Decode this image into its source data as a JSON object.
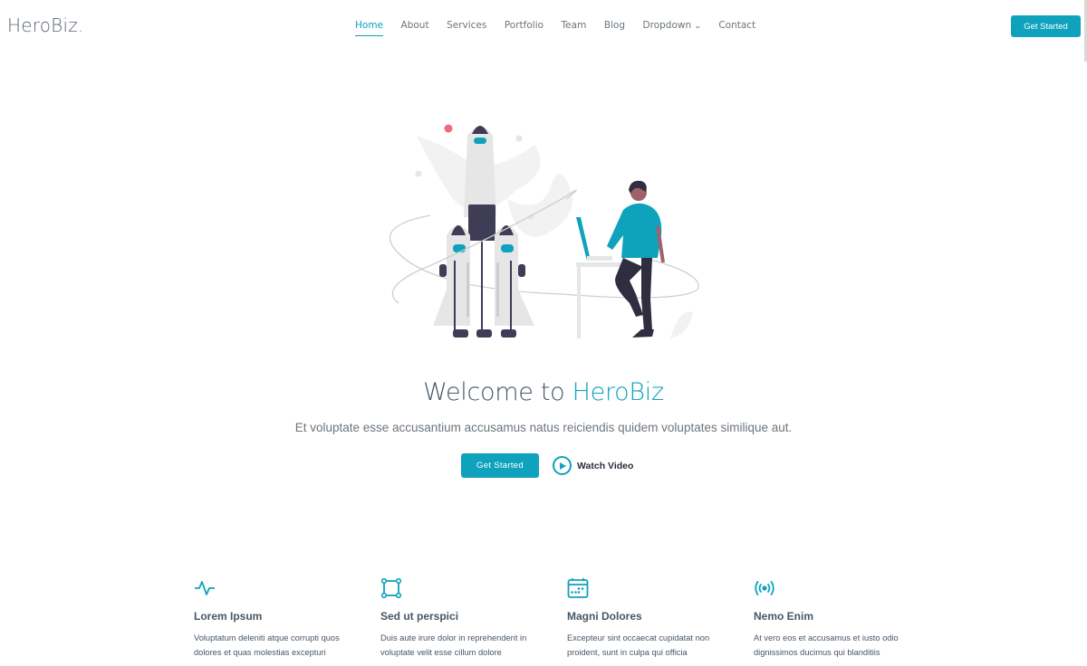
{
  "header": {
    "logo": "HeroBiz",
    "logo_dot": ".",
    "nav": [
      {
        "label": "Home",
        "active": true
      },
      {
        "label": "About"
      },
      {
        "label": "Services"
      },
      {
        "label": "Portfolio"
      },
      {
        "label": "Team"
      },
      {
        "label": "Blog"
      },
      {
        "label": "Dropdown",
        "icon": "chevron-down-icon"
      },
      {
        "label": "Contact"
      }
    ],
    "cta": "Get Started"
  },
  "hero": {
    "title_prefix": "Welcome to ",
    "title_brand": "HeroBiz",
    "subtitle": "Et voluptate esse accusantium accusamus natus reiciendis quidem voluptates similique aut.",
    "primary_button": "Get Started",
    "video_button": "Watch Video",
    "illustration": "rocket-launch-illustration"
  },
  "features": [
    {
      "icon": "activity-icon",
      "title": "Lorem Ipsum",
      "text": "Voluptatum deleniti atque corrupti quos dolores et quas molestias excepturi"
    },
    {
      "icon": "bounding-box-icon",
      "title": "Sed ut perspici",
      "text": "Duis aute irure dolor in reprehenderit in voluptate velit esse cillum dolore"
    },
    {
      "icon": "calendar-icon",
      "title": "Magni Dolores",
      "text": "Excepteur sint occaecat cupidatat non proident, sunt in culpa qui officia"
    },
    {
      "icon": "broadcast-icon",
      "title": "Nemo Enim",
      "text": "At vero eos et accusamus et iusto odio dignissimos ducimus qui blanditiis"
    }
  ],
  "colors": {
    "accent": "#0ea2bd",
    "text": "#485664",
    "dark": "#3f3d56"
  }
}
